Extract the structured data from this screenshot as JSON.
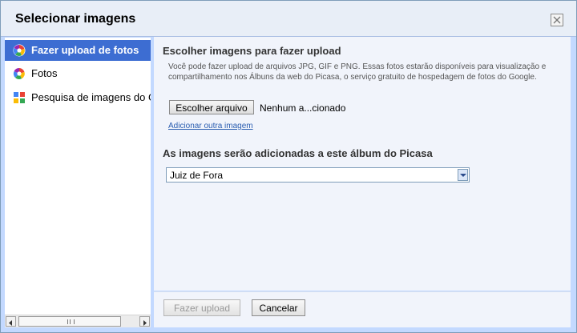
{
  "dialog": {
    "title": "Selecionar imagens"
  },
  "sidebar": {
    "items": [
      {
        "label": "Fazer upload de fotos",
        "icon": "picasa-icon",
        "active": true
      },
      {
        "label": "Fotos",
        "icon": "picasa-icon",
        "active": false
      },
      {
        "label": "Pesquisa de imagens do Google",
        "icon": "google-search-icon",
        "active": false
      }
    ]
  },
  "upload": {
    "heading": "Escolher imagens para fazer upload",
    "description": "Você pode fazer upload de arquivos JPG, GIF e PNG. Essas fotos estarão disponíveis para visualização e compartilhamento nos Álbuns da web do Picasa, o serviço gratuito de hospedagem de fotos do Google.",
    "choose_file_label": "Escolher arquivo",
    "file_status": "Nenhum a...cionado",
    "add_another_link": "Adicionar outra imagem"
  },
  "album": {
    "heading": "As imagens serão adicionadas a este álbum do Picasa",
    "selected": "Juiz de Fora"
  },
  "footer": {
    "upload_label": "Fazer upload",
    "cancel_label": "Cancelar"
  },
  "colors": {
    "accent": "#3d6dd2",
    "dialog_bg": "#c3d9ff",
    "link": "#2a5db0"
  }
}
